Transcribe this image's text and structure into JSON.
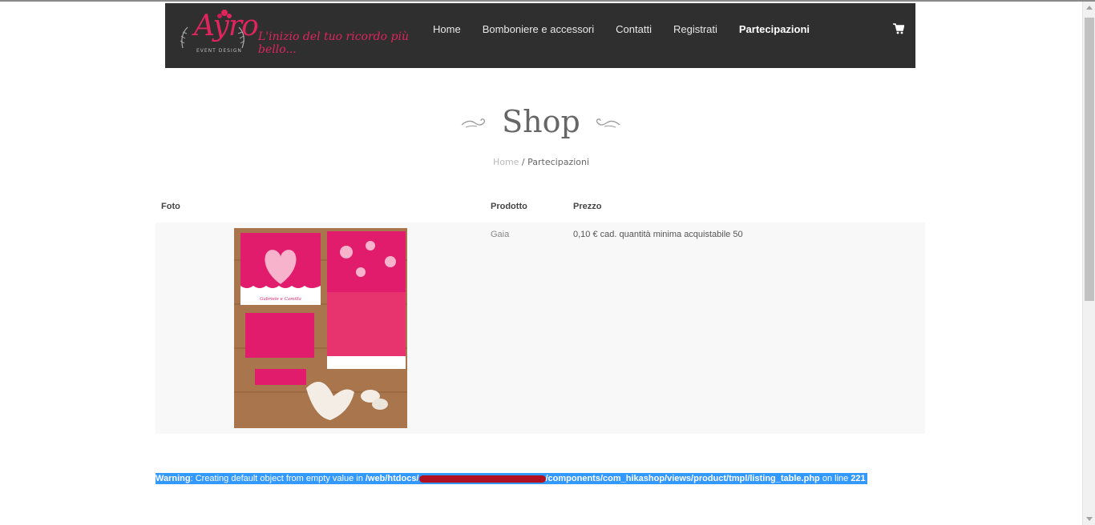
{
  "header": {
    "logo_word": "Ayro",
    "logo_sub": "EVENT DESIGN",
    "tagline": "L'inizio del tuo ricordo più bello...",
    "nav": [
      {
        "label": "Home"
      },
      {
        "label": "Bomboniere e accessori"
      },
      {
        "label": "Contatti"
      },
      {
        "label": "Registrati"
      },
      {
        "label": "Partecipazioni",
        "active": true
      }
    ],
    "cart_icon": "cart-icon"
  },
  "page": {
    "title": "Shop",
    "breadcrumb": {
      "home": "Home",
      "separator": "/",
      "current": "Partecipazioni"
    }
  },
  "table": {
    "columns": [
      "Foto",
      "Prodotto",
      "Prezzo"
    ],
    "rows": [
      {
        "name": "Gaia",
        "price": "0,10 € cad. quantità minima acquistabile 50",
        "image_card_text": "Gabriele e Camilla"
      }
    ]
  },
  "warning": {
    "label": "Warning",
    "message": ": Creating default object from empty value in ",
    "path_start": "/web/htdocs/",
    "path_end": "/components/com_hikashop/views/product/tmpl/listing_table.php",
    "on_line": " on line ",
    "line": "221"
  },
  "colors": {
    "brand": "#e0245e",
    "header_bg": "#2f2f2f",
    "selection": "#3399ff"
  }
}
